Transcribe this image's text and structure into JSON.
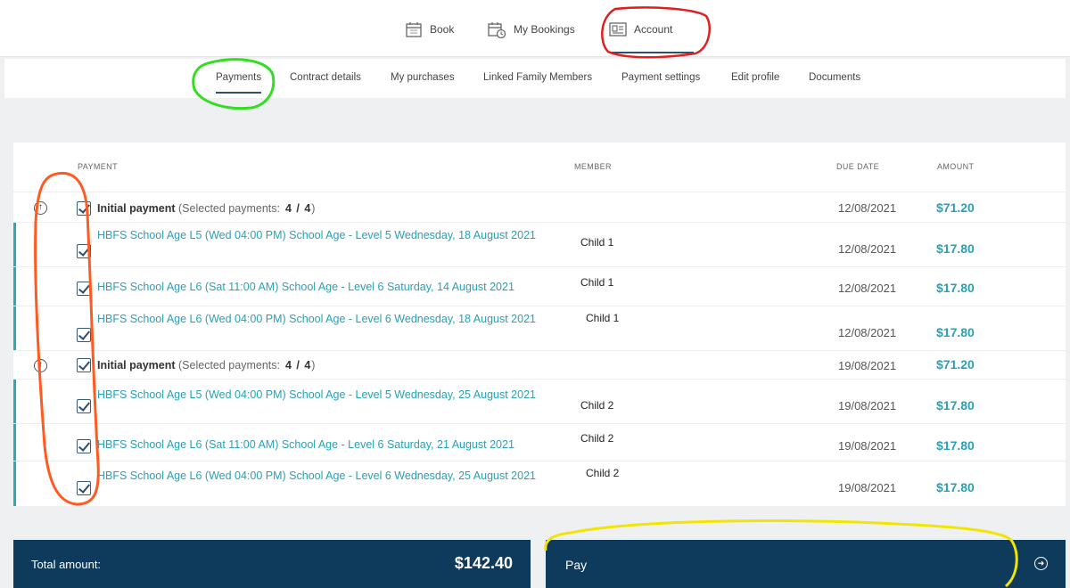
{
  "topnav": {
    "items": [
      {
        "label": "Book",
        "icon": "calendar-icon"
      },
      {
        "label": "My Bookings",
        "icon": "calendar-clock-icon"
      },
      {
        "label": "Account",
        "icon": "id-card-icon",
        "active": true
      }
    ]
  },
  "subnav": {
    "tabs": [
      {
        "label": "Payments",
        "active": true
      },
      {
        "label": "Contract details"
      },
      {
        "label": "My purchases"
      },
      {
        "label": "Linked Family Members"
      },
      {
        "label": "Payment settings"
      },
      {
        "label": "Edit profile"
      },
      {
        "label": "Documents"
      }
    ]
  },
  "table": {
    "headers": {
      "payment": "PAYMENT",
      "member": "MEMBER",
      "due_date": "DUE DATE",
      "amount": "AMOUNT"
    },
    "groups": [
      {
        "title": "Initial payment",
        "selected_label": "(Selected payments:",
        "selected_count": "4 / 4",
        "selected_close": ")",
        "due": "12/08/2021",
        "amount": "$71.20",
        "items": [
          {
            "desc": "HBFS School Age L5 (Wed 04:00 PM) School Age - Level 5 Wednesday, 18 August 2021",
            "member": "Child 1",
            "due": "12/08/2021",
            "amount": "$17.80"
          },
          {
            "desc": "HBFS School Age L6 (Sat 11:00 AM) School Age - Level 6 Saturday, 14 August 2021",
            "member": "Child 1",
            "due": "12/08/2021",
            "amount": "$17.80"
          },
          {
            "desc": "HBFS School Age L6 (Wed 04:00 PM) School Age - Level 6 Wednesday, 18 August 2021",
            "member": "Child 1",
            "due": "12/08/2021",
            "amount": "$17.80"
          }
        ]
      },
      {
        "title": "Initial payment",
        "selected_label": "(Selected payments:",
        "selected_count": "4 / 4",
        "selected_close": ")",
        "due": "19/08/2021",
        "amount": "$71.20",
        "items": [
          {
            "desc": "HBFS School Age L5 (Wed 04:00 PM) School Age - Level 5 Wednesday, 25 August 2021",
            "member": "Child 2",
            "due": "19/08/2021",
            "amount": "$17.80"
          },
          {
            "desc": "HBFS School Age L6 (Sat 11:00 AM) School Age - Level 6 Saturday, 21 August 2021",
            "member": "Child 2",
            "due": "19/08/2021",
            "amount": "$17.80"
          },
          {
            "desc": "HBFS School Age L6 (Wed 04:00 PM) School Age - Level 6 Wednesday, 25 August 2021",
            "member": "Child 2",
            "due": "19/08/2021",
            "amount": "$17.80"
          }
        ]
      }
    ]
  },
  "footer": {
    "total_label": "Total amount:",
    "total_value": "$142.40",
    "pay_label": "Pay",
    "pay_icon": "arrow-right-circle-icon"
  },
  "colors": {
    "accent": "#2aa0b5",
    "navy": "#0e3a5c",
    "annotation_red": "#e02020",
    "annotation_green": "#33dd22",
    "annotation_orange": "#ff5a1f",
    "annotation_yellow": "#f2e600"
  }
}
